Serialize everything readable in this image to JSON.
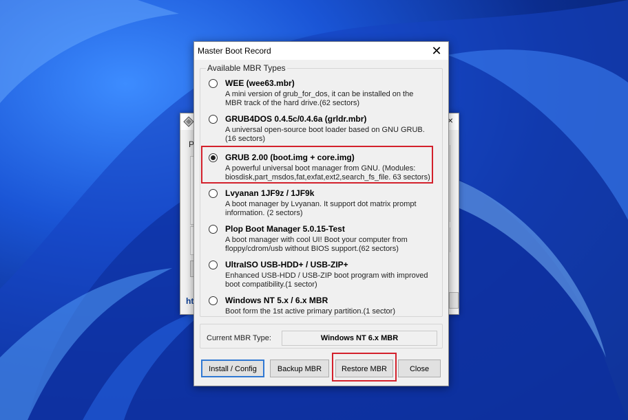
{
  "background_window": {
    "tab_label": "P",
    "link_text": "ht",
    "close_glyph": "×"
  },
  "dialog": {
    "title": "Master Boot Record",
    "close_glyph": "✕",
    "group_label": "Available MBR Types",
    "options": [
      {
        "title": "WEE (wee63.mbr)",
        "desc": "A mini version of grub_for_dos, it can be installed on the MBR track of the hard drive.(62 sectors)",
        "checked": false
      },
      {
        "title": "GRUB4DOS 0.4.5c/0.4.6a (grldr.mbr)",
        "desc": "A universal open-source boot loader based on GNU GRUB.(16 sectors)",
        "checked": false
      },
      {
        "title": "GRUB 2.00 (boot.img + core.img)",
        "desc": "A powerful universal boot manager from GNU. (Modules: biosdisk,part_msdos,fat,exfat,ext2,search_fs_file. 63 sectors)",
        "checked": true
      },
      {
        "title": "Lvyanan 1JF9z / 1JF9k",
        "desc": "A boot manager by Lvyanan. It support dot matrix prompt information. (2 sectors)",
        "checked": false
      },
      {
        "title": "Plop Boot Manager 5.0.15-Test",
        "desc": "A boot manager with cool UI! Boot your computer from floppy/cdrom/usb without BIOS support.(62 sectors)",
        "checked": false
      },
      {
        "title": "UltraISO USB-HDD+ / USB-ZIP+",
        "desc": "Enhanced USB-HDD / USB-ZIP boot program with improved boot compatibility.(1 sector)",
        "checked": false
      },
      {
        "title": "Windows NT 5.x / 6.x MBR",
        "desc": "Boot form the 1st active primary partition.(1 sector)",
        "checked": false
      }
    ],
    "current_label": "Current MBR Type:",
    "current_value": "Windows NT 6.x MBR",
    "buttons": {
      "install": "Install / Config",
      "backup": "Backup MBR",
      "restore": "Restore MBR",
      "close": "Close"
    }
  },
  "colors": {
    "highlight": "#d3202b",
    "default_button_border": "#2f78d3"
  }
}
